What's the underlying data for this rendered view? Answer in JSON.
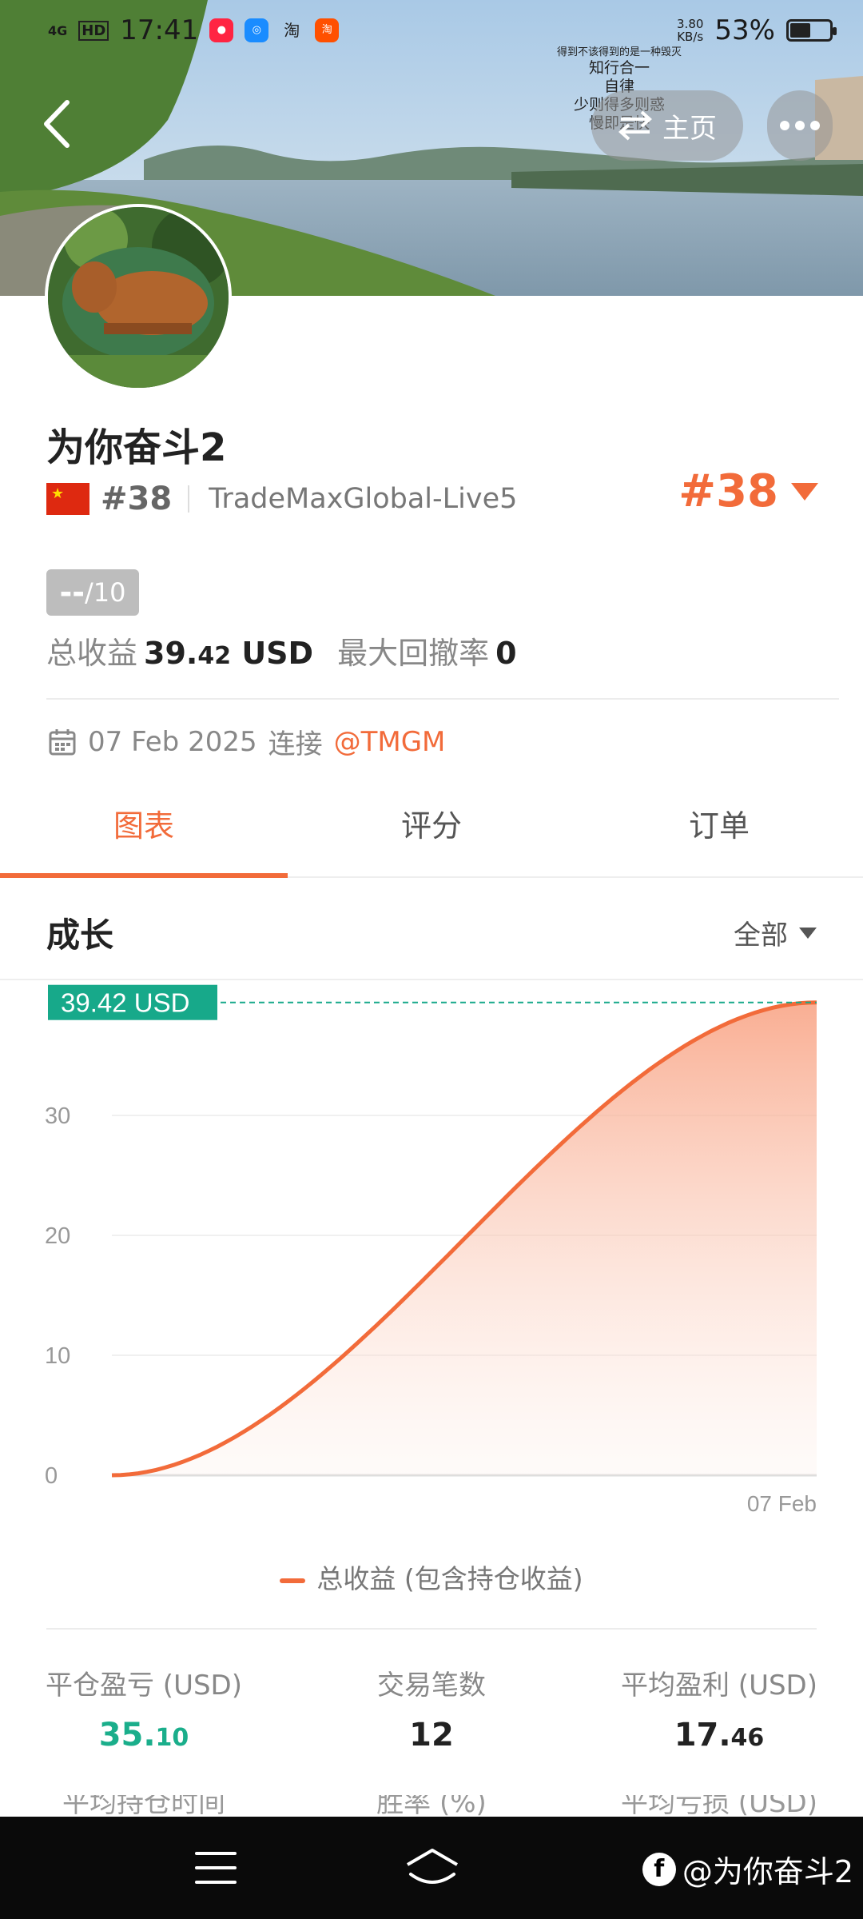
{
  "status_bar": {
    "network": "4G",
    "hd": "HD",
    "time": "17:41",
    "speed_value": "3.80",
    "speed_unit": "KB/s",
    "battery": "53%",
    "battery_level": 0.53,
    "app_icons": [
      "小红书",
      "browser",
      "淘",
      "淘"
    ]
  },
  "header": {
    "home_label": "主页",
    "quote_line1": "得到不该得到的是一种毁灭",
    "quote_line2": "知行合一",
    "quote_line3": "自律",
    "quote_line4": "少则得多则惑",
    "quote_line5": "慢即是快"
  },
  "profile": {
    "name": "为你奋斗2",
    "rank_small": "#38",
    "server": "TradeMaxGlobal-Live5",
    "rank_big": "#38",
    "score_dash": "--",
    "score_max": "/10",
    "total_profit_label": "总收益",
    "total_profit_int": "39.",
    "total_profit_dec": "42",
    "total_profit_unit": " USD",
    "drawdown_label": "最大回撤率",
    "drawdown_value": "0",
    "since_date": "07 Feb 2025",
    "since_text": "连接",
    "broker": "@TMGM"
  },
  "tabs": [
    "图表",
    "评分",
    "订单"
  ],
  "growth": {
    "title": "成长",
    "filter": "全部"
  },
  "chart_data": {
    "type": "area",
    "x": [
      "",
      "07 Feb"
    ],
    "values": [
      0,
      39.42
    ],
    "series": [
      {
        "name": "总收益 (包含持仓收益)",
        "values": [
          0,
          39.42
        ]
      }
    ],
    "current_label": "39.42 USD",
    "y_ticks": [
      "0",
      "10",
      "20",
      "30"
    ],
    "x_tick": "07 Feb",
    "ylim": [
      0,
      40
    ],
    "line_color": "#f26b3a",
    "marker_color": "#17a98a"
  },
  "legend": "总收益 (包含持仓收益)",
  "metrics": [
    {
      "label": "平仓盈亏 (USD)",
      "int": "35.",
      "dec": "10"
    },
    {
      "label": "交易笔数",
      "int": "12",
      "dec": ""
    },
    {
      "label": "平均盈利 (USD)",
      "int": "17.",
      "dec": "46"
    }
  ],
  "metrics_next": [
    "平均持仓时间",
    "胜率 (%)",
    "平均亏损 (USD)"
  ],
  "watermark": "@为你奋斗2",
  "colors": {
    "accent": "#f26b3a",
    "green": "#1aae8b"
  }
}
